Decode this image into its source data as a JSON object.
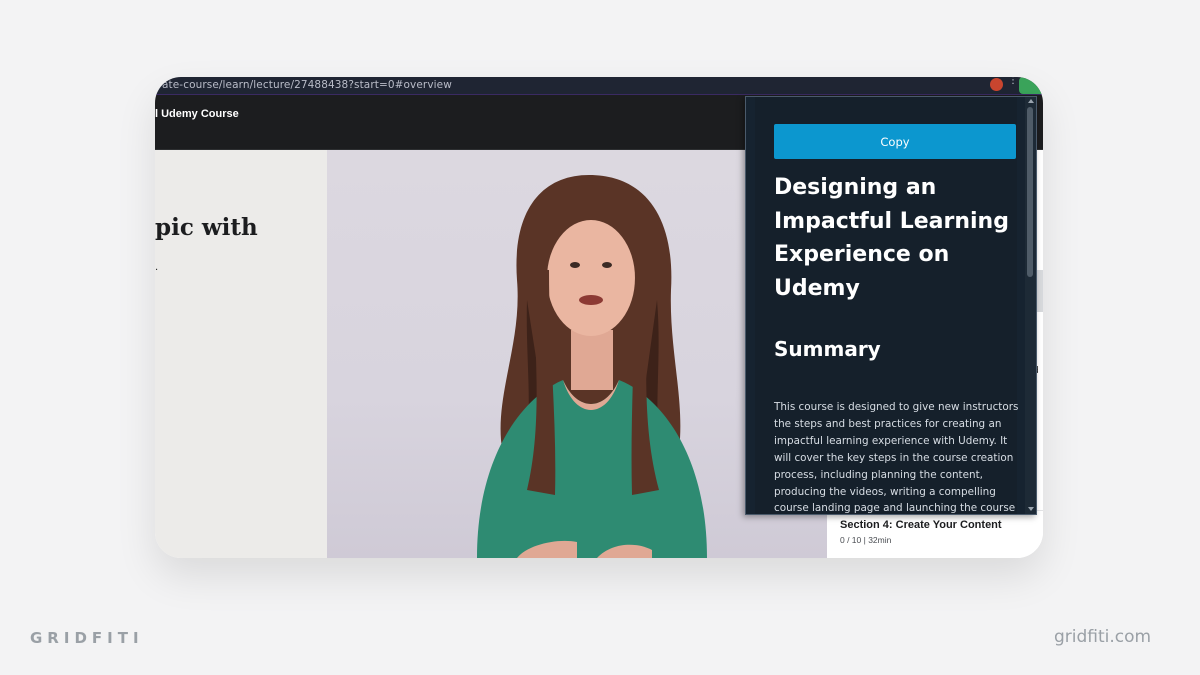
{
  "browser": {
    "url": "ate-course/learn/lecture/27488438?start=0#overview"
  },
  "course_header": {
    "title": "l Udemy Course"
  },
  "lecture": {
    "heading_fragment": "pic with",
    "dot": "."
  },
  "sidebar": {
    "fragment": "d",
    "section": {
      "title": "Section 4: Create Your Content",
      "meta": "0 / 10 | 32min"
    }
  },
  "summary_popup": {
    "copy_label": "Copy",
    "title": "Designing an Impactful Learning Experience on Udemy",
    "heading": "Summary",
    "body": "This course is designed to give new instructors the steps and best practices for creating an impactful learning experience with Udemy. It will cover the key steps in the course creation process, including planning the content, producing the videos, writing a compelling course landing page and launching the course"
  },
  "branding": {
    "left": "GRIDFITI",
    "right": "gridfiti.com"
  },
  "colors": {
    "page_bg": "#f3f3f4",
    "popup_bg": "#15202b",
    "copy_button": "#0c97cf",
    "course_header": "#1c1d1f",
    "presenter_top": "#2e8b72"
  },
  "icons": [
    "brave-extension-icon",
    "extension-icon",
    "more-options-icon"
  ]
}
